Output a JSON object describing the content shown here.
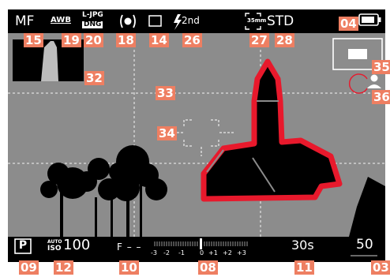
{
  "colors": {
    "screen_bg": "#8c8c8c",
    "bar_bg": "#000000",
    "text": "#ffffff",
    "badge_bg": "#ee7f62",
    "badge_text": "#ffffff",
    "focus_peaking": "#e8192c",
    "silhouette": "#000000"
  },
  "top_bar": {
    "focus_mode": "MF",
    "white_balance": "AWB",
    "file_format_top": "L-JPG",
    "file_format_bottom": "DNG",
    "metering_icon": "spot-metering-icon",
    "drive_icon": "single-frame-icon",
    "flash_icon": "flash-icon",
    "flash_mode": "2nd",
    "crop_label": "35mm",
    "film_style": "STD",
    "battery_icon": "battery-icon"
  },
  "bottom_bar": {
    "exposure_mode": "P",
    "iso_auto": "AUTO",
    "iso_label": "ISO",
    "iso_value": "100",
    "aperture": "F – –",
    "scale_labels": [
      "-3",
      "-2",
      "-1",
      "0",
      "+1",
      "+2",
      "+3"
    ],
    "shutter": "30s",
    "remaining_shots": "50"
  },
  "callouts": {
    "c03": "03",
    "c04": "04",
    "c08": "08",
    "c09": "09",
    "c10": "10",
    "c11": "11",
    "c12": "12",
    "c14": "14",
    "c15": "15",
    "c18": "18",
    "c19": "19",
    "c20": "20",
    "c26": "26",
    "c27": "27",
    "c28": "28",
    "c32": "32",
    "c33": "33",
    "c34": "34",
    "c35": "35",
    "c36": "36"
  }
}
